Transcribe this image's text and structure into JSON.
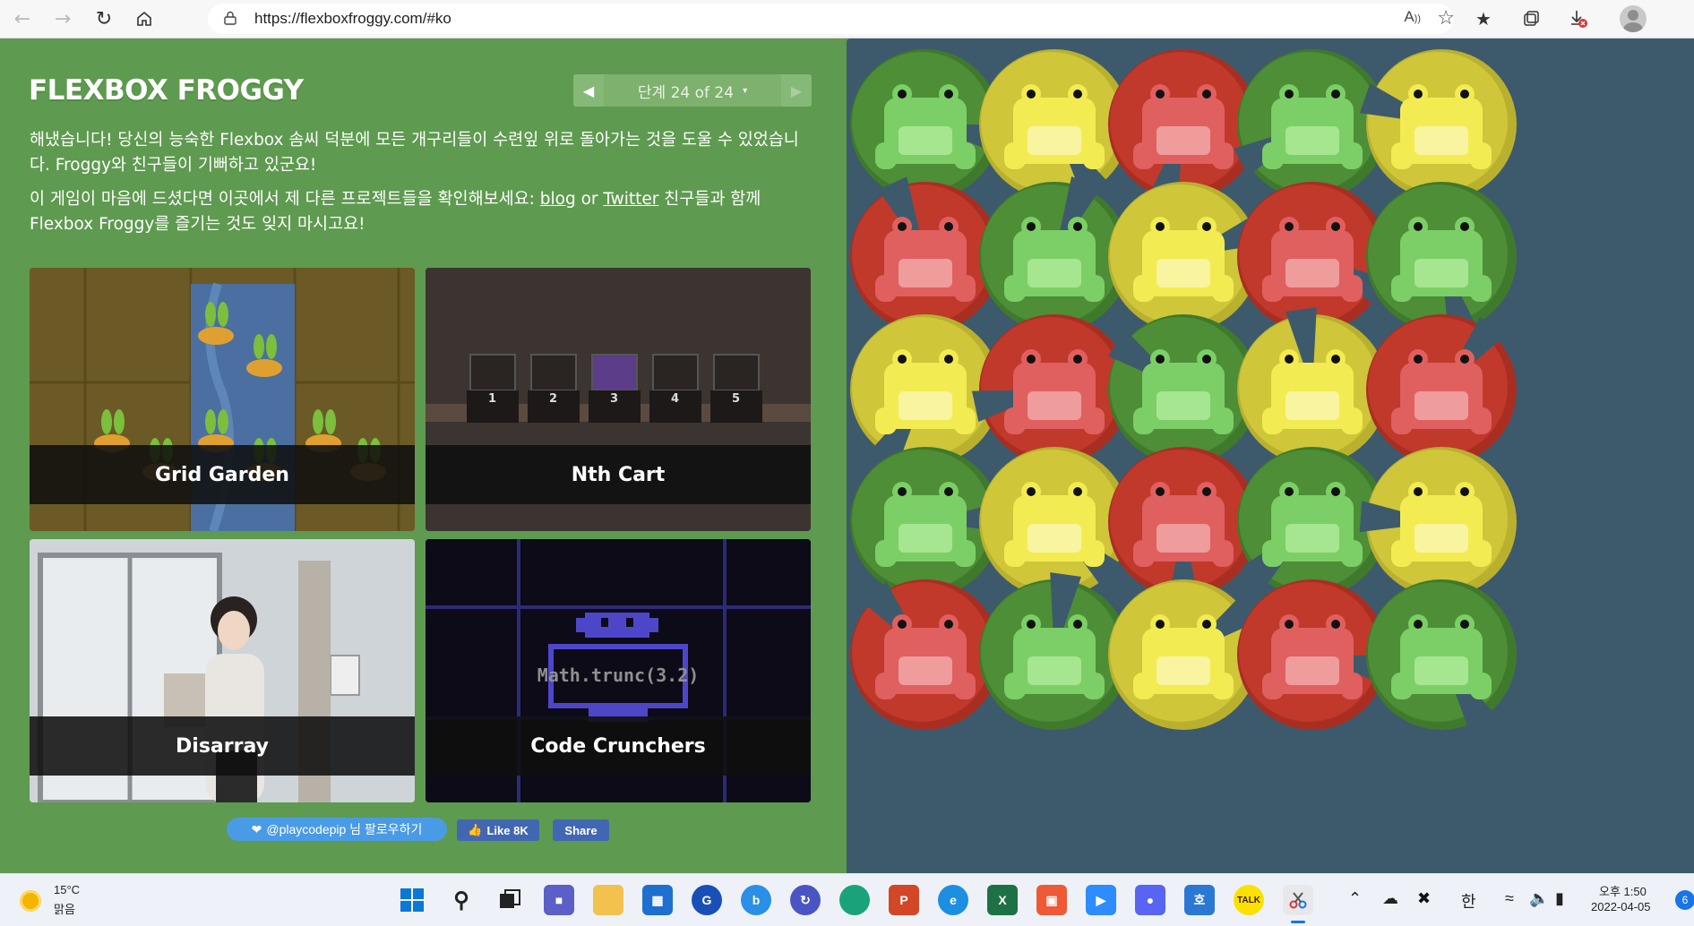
{
  "browser": {
    "url": "https://flexboxfroggy.com/#ko",
    "read_aloud_label": "A",
    "back_icon": "arrow-left-icon",
    "forward_icon": "arrow-right-icon",
    "reload_icon": "reload-icon",
    "home_icon": "home-icon"
  },
  "header": {
    "logo": "FLEXBOX FROGGY",
    "level_indicator": "단계 24 of 24",
    "level_caret": "▾"
  },
  "intro": {
    "para1": "해냈습니다! 당신의 능숙한 Flexbox 솜씨 덕분에 모든 개구리들이 수련잎 위로 돌아가는 것을 도울 수 있었습니다. Froggy와 친구들이 기뻐하고 있군요!",
    "para2_before": "이 게임이 마음에 드셨다면 이곳에서 제 다른 프로젝트들을 확인해보세요: ",
    "para2_blog": "blog",
    "para2_or": " or ",
    "para2_twitter": "Twitter",
    "para2_after": " 친구들과 함께 Flexbox Froggy를 즐기는 것도 잊지 마시고요!"
  },
  "cards": {
    "grid_garden": "Grid Garden",
    "nth_cart": "Nth Cart",
    "disarray": "Disarray",
    "code_crunchers": "Code Crunchers",
    "code_crunchers_code": "Math.trunc(3.2)",
    "cart_numbers": [
      "1",
      "2",
      "3",
      "4",
      "5"
    ]
  },
  "social": {
    "twitter_follow": "@playcodepip 님 팔로우하기",
    "fb_like": "Like 8K",
    "fb_share": "Share"
  },
  "pond": {
    "colors": {
      "green": "#4d8e37",
      "yellow": "#cfc63a",
      "red": "#c0392b"
    },
    "rows": [
      [
        "green",
        "yellow",
        "red",
        "green",
        "yellow"
      ],
      [
        "red",
        "green",
        "yellow",
        "red",
        "green"
      ],
      [
        "yellow",
        "red",
        "green",
        "yellow",
        "red"
      ],
      [
        "green",
        "yellow",
        "red",
        "green",
        "yellow"
      ],
      [
        "red",
        "green",
        "yellow",
        "red",
        "green"
      ]
    ]
  },
  "taskbar": {
    "weather_temp": "15°C",
    "weather_desc": "맑음",
    "ime": "한",
    "clock_time": "오후 1:50",
    "clock_date": "2022-04-05",
    "notifications": "6",
    "apps": [
      "start-icon",
      "search-icon",
      "task-view-icon",
      "teams-icon",
      "file-explorer-icon",
      "store-icon",
      "app-g-icon",
      "bing-icon",
      "remote-icon",
      "edge-dev-icon",
      "powerpoint-icon",
      "edge-icon",
      "excel-icon",
      "app-red-icon",
      "zoom-icon",
      "discord-icon",
      "pinyin-icon",
      "kakaotalk-icon",
      "snipping-tool-icon"
    ],
    "kakaotalk_label": "TALK"
  }
}
